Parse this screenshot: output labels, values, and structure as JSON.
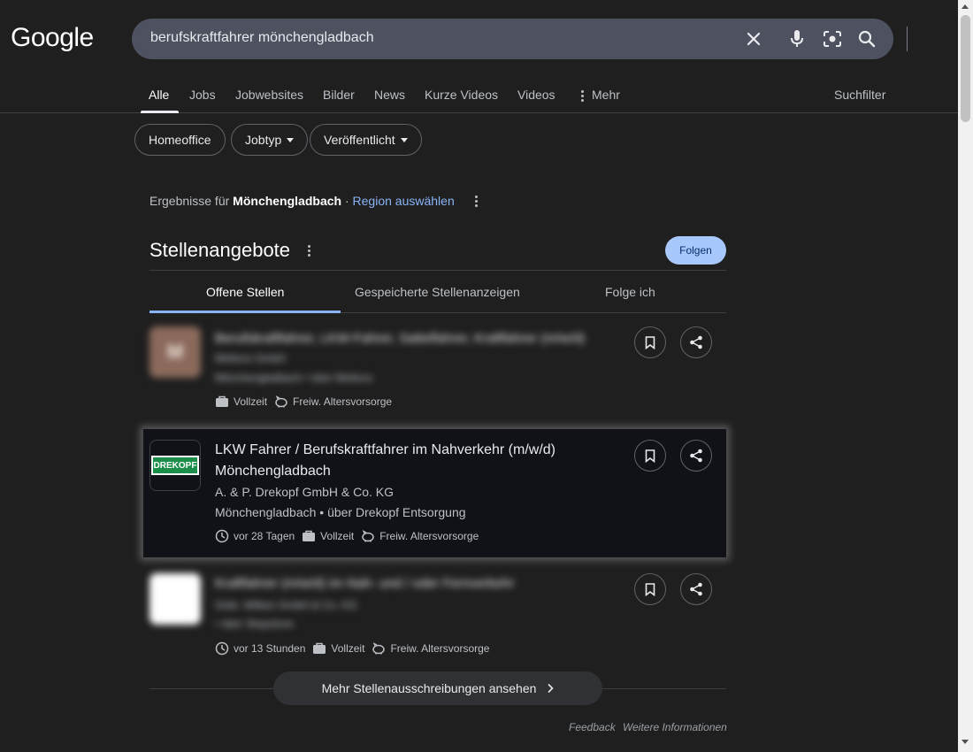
{
  "logo": "Google",
  "search": {
    "query": "berufskraftfahrer mönchengladbach"
  },
  "tabs": [
    {
      "label": "Alle",
      "active": true
    },
    {
      "label": "Jobs"
    },
    {
      "label": "Jobwebsites"
    },
    {
      "label": "Bilder"
    },
    {
      "label": "News"
    },
    {
      "label": "Kurze Videos"
    },
    {
      "label": "Videos"
    },
    {
      "label": "Mehr"
    }
  ],
  "filter_tools": "Suchfilter",
  "chips": [
    {
      "label": "Homeoffice"
    },
    {
      "label": "Jobtyp"
    },
    {
      "label": "Veröffentlicht"
    }
  ],
  "region": {
    "prefix": "Ergebnisse für ",
    "city": "Mönchengladbach",
    "sep": " · ",
    "link": "Region auswählen"
  },
  "jobs_section": {
    "title": "Stellenangebote",
    "follow": "Folgen",
    "tabs": [
      "Offene Stellen",
      "Gespeicherte Stellenanzeigen",
      "Folge ich"
    ]
  },
  "jobs": [
    {
      "title": "Berufskraftfahrer, LKW-Fahrer, Sattelfahrer, Kraftfahrer (m/w/d)",
      "company": "Meltons GmbH",
      "location": "Mönchengladbach • über Meltons",
      "logo_letter": "M",
      "meta": [
        "Vollzeit",
        "Freiw. Altersvorsorge"
      ]
    },
    {
      "title": "LKW Fahrer / Berufskraftfahrer im Nahverkehr (m/w/d) Mönchengladbach",
      "company": "A. & P. Drekopf GmbH & Co. KG",
      "location": "Mönchengladbach • über Drekopf Entsorgung",
      "logo_text": "DREKOPF",
      "meta": [
        "vor 28 Tagen",
        "Vollzeit",
        "Freiw. Altersvorsorge"
      ]
    },
    {
      "title": "Kraftfahrer (m/w/d) im Nah- und / oder Fernverkehr",
      "company": "Gebr. Wilken GmbH & Co. KG",
      "location": "• über Stepstone",
      "meta": [
        "vor 13 Stunden",
        "Vollzeit",
        "Freiw. Altersvorsorge"
      ]
    }
  ],
  "more_jobs": "Mehr Stellenausschreibungen ansehen",
  "footer": {
    "feedback": "Feedback",
    "info": "Weitere Informationen"
  }
}
